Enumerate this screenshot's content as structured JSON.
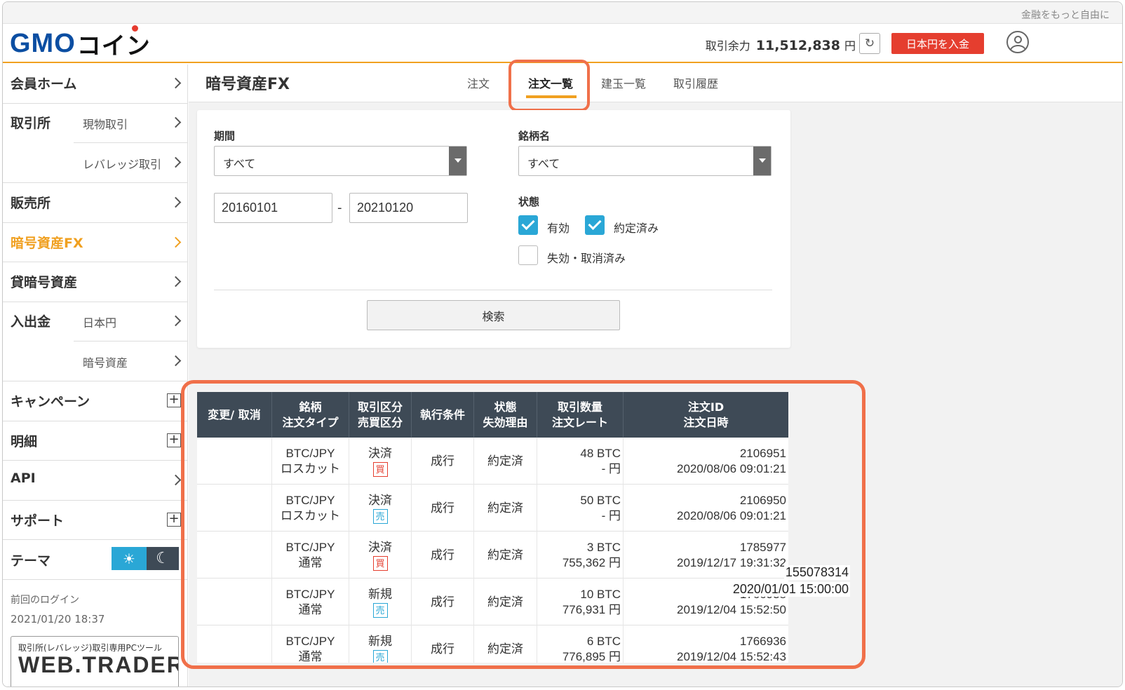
{
  "topbar": {
    "tagline": "金融をもっと自由に"
  },
  "header": {
    "logo_latin": "GMO",
    "logo_kana": "コイン",
    "balance_label": "取引余力",
    "balance_amount": "11,512,838",
    "balance_unit": "円",
    "refresh_icon": "↻",
    "deposit_label": "日本円を入金"
  },
  "sidebar": {
    "home": "会員ホーム",
    "exchange": "取引所",
    "exchange_spot": "現物取引",
    "exchange_leverage": "レバレッジ取引",
    "otc": "販売所",
    "crypto_fx": "暗号資産FX",
    "lending": "貸暗号資産",
    "deposit": "入出金",
    "deposit_jpy": "日本円",
    "deposit_crypto": "暗号資産",
    "campaign": "キャンペーン",
    "statement": "明細",
    "api": "API",
    "support": "サポート",
    "theme": "テーマ",
    "plus": "+",
    "sun_icon": "☀",
    "moon_icon": "☾",
    "last_login_label": "前回のログイン",
    "last_login_time": "2021/01/20 18:37",
    "banner_top": "取引所(レバレッジ)取引専用PCツール",
    "banner_title": "WEB.TRADER"
  },
  "main": {
    "title": "暗号資産FX",
    "tabs": [
      "注文",
      "注文一覧",
      "建玉一覧",
      "取引履歴"
    ],
    "active_tab": "注文一覧"
  },
  "filters": {
    "period_label": "期間",
    "period_value": "すべて",
    "symbol_label": "銘柄名",
    "symbol_value": "すべて",
    "date_from": "20160101",
    "date_to": "20210120",
    "dash": "-",
    "status_label": "状態",
    "status_active": "有効",
    "status_executed": "約定済み",
    "status_expired": "失効・取消済み",
    "search_label": "検索"
  },
  "table": {
    "headers": [
      [
        "変更/ 取消"
      ],
      [
        "銘柄",
        "注文タイプ"
      ],
      [
        "取引区分",
        "売買区分"
      ],
      [
        "執行条件"
      ],
      [
        "状態",
        "失効理由"
      ],
      [
        "取引数量",
        "注文レート"
      ],
      [
        "注文ID",
        "注文日時"
      ]
    ],
    "rows": [
      {
        "symbol": "BTC/JPY",
        "type": "ロスカット",
        "kind": "決済",
        "side": "買",
        "side_class": "buy",
        "condition": "成行",
        "status": "約定済",
        "qty": "48 BTC",
        "rate": "- 円",
        "id": "2106951",
        "datetime": "2020/08/06 09:01:21"
      },
      {
        "symbol": "BTC/JPY",
        "type": "ロスカット",
        "kind": "決済",
        "side": "売",
        "side_class": "sell",
        "condition": "成行",
        "status": "約定済",
        "qty": "50 BTC",
        "rate": "- 円",
        "id": "2106950",
        "datetime": "2020/08/06 09:01:21"
      },
      {
        "symbol": "BTC/JPY",
        "type": "通常",
        "kind": "決済",
        "side": "買",
        "side_class": "buy",
        "condition": "成行",
        "status": "約定済",
        "qty": "3 BTC",
        "rate": "755,362 円",
        "id": "1785977",
        "datetime": "2019/12/17 19:31:32"
      },
      {
        "symbol": "BTC/JPY",
        "type": "通常",
        "kind": "新規",
        "side": "売",
        "side_class": "sell",
        "condition": "成行",
        "status": "約定済",
        "qty": "10 BTC",
        "rate": "776,931 円",
        "id": "1766938",
        "datetime": "2019/12/04 15:52:50"
      },
      {
        "symbol": "BTC/JPY",
        "type": "通常",
        "kind": "新規",
        "side": "売",
        "side_class": "sell",
        "condition": "成行",
        "status": "約定済",
        "qty": "6 BTC",
        "rate": "776,895 円",
        "id": "1766936",
        "datetime": "2019/12/04 15:52:43"
      }
    ],
    "overlay_id": "155078314",
    "overlay_datetime": "2020/01/01 15:00:00"
  }
}
